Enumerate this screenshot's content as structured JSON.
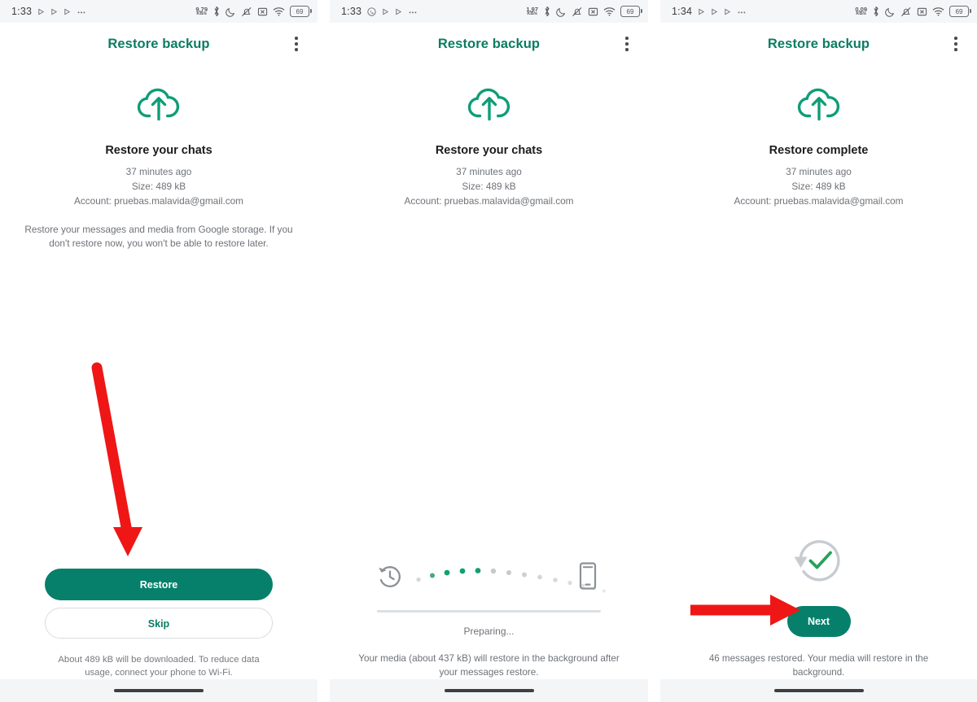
{
  "colors": {
    "brand_green": "#06806a",
    "title_green": "#0a7d63",
    "accent_check": "#25a35a",
    "annotation_red": "#ef1616",
    "muted_text": "#6e7278",
    "status_bg": "#f5f6f8"
  },
  "panels": [
    {
      "id": "panel-restore-prompt",
      "statusbar": {
        "time": "1:33",
        "net_speed_value": "9.79",
        "net_speed_unit": "KB/s",
        "battery_level": "69",
        "icons": [
          "play-icon",
          "play-icon",
          "play-icon",
          "overflow-dots-icon"
        ],
        "right_icons": [
          "bluetooth-icon",
          "do-not-disturb-moon-icon",
          "alarm-off-icon",
          "mute-icon",
          "wifi-icon",
          "battery-icon"
        ],
        "has_whatsapp_icon": false
      },
      "appbar": {
        "title": "Restore backup",
        "menu": "more-options"
      },
      "hero_icon": "cloud-upload-icon",
      "headline": "Restore your chats",
      "meta": [
        "37 minutes ago",
        "Size: 489 kB",
        "Account: pruebas.malavida@gmail.com"
      ],
      "description": "Restore your messages and media from Google storage. If you don't restore now, you won't be able to restore later.",
      "primary_button": "Restore",
      "secondary_button": "Skip",
      "footnote": "About 489 kB will be downloaded. To reduce data usage, connect your phone to Wi-Fi.",
      "annotation": "red-arrow-pointing-down-to-restore-button"
    },
    {
      "id": "panel-restoring-progress",
      "statusbar": {
        "time": "1:33",
        "net_speed_value": "1.97",
        "net_speed_unit": "KB/s",
        "battery_level": "69",
        "icons": [
          "whatsapp-icon",
          "play-icon",
          "play-icon",
          "overflow-dots-icon"
        ],
        "right_icons": [
          "bluetooth-icon",
          "do-not-disturb-moon-icon",
          "alarm-off-icon",
          "mute-icon",
          "wifi-icon",
          "battery-icon"
        ],
        "has_whatsapp_icon": true
      },
      "appbar": {
        "title": "Restore backup",
        "menu": "more-options"
      },
      "hero_icon": "cloud-upload-icon",
      "headline": "Restore your chats",
      "meta": [
        "37 minutes ago",
        "Size: 489 kB",
        "Account: pruebas.malavida@gmail.com"
      ],
      "progress": {
        "left_icon": "history-restore-icon",
        "right_icon": "phone-device-icon",
        "status_label": "Preparing...",
        "dot_count": 14,
        "active_dots": 5,
        "bar_percent": 0
      },
      "note": "Your media (about 437 kB) will restore in the background after your messages restore."
    },
    {
      "id": "panel-restore-complete",
      "statusbar": {
        "time": "1:34",
        "net_speed_value": "0.09",
        "net_speed_unit": "KB/s",
        "battery_level": "69",
        "icons": [
          "play-icon",
          "play-icon",
          "play-icon",
          "overflow-dots-icon"
        ],
        "right_icons": [
          "bluetooth-icon",
          "do-not-disturb-moon-icon",
          "alarm-off-icon",
          "mute-icon",
          "wifi-icon",
          "battery-icon"
        ],
        "has_whatsapp_icon": false
      },
      "appbar": {
        "title": "Restore backup",
        "menu": "more-options"
      },
      "hero_icon": "cloud-upload-icon",
      "headline": "Restore complete",
      "meta": [
        "37 minutes ago",
        "Size: 489 kB",
        "Account: pruebas.malavida@gmail.com"
      ],
      "complete_icon": "circular-arrow-check-icon",
      "primary_button": "Next",
      "note": "46 messages restored. Your media will restore in the background.",
      "annotation": "red-arrow-pointing-right-to-next-button"
    }
  ]
}
